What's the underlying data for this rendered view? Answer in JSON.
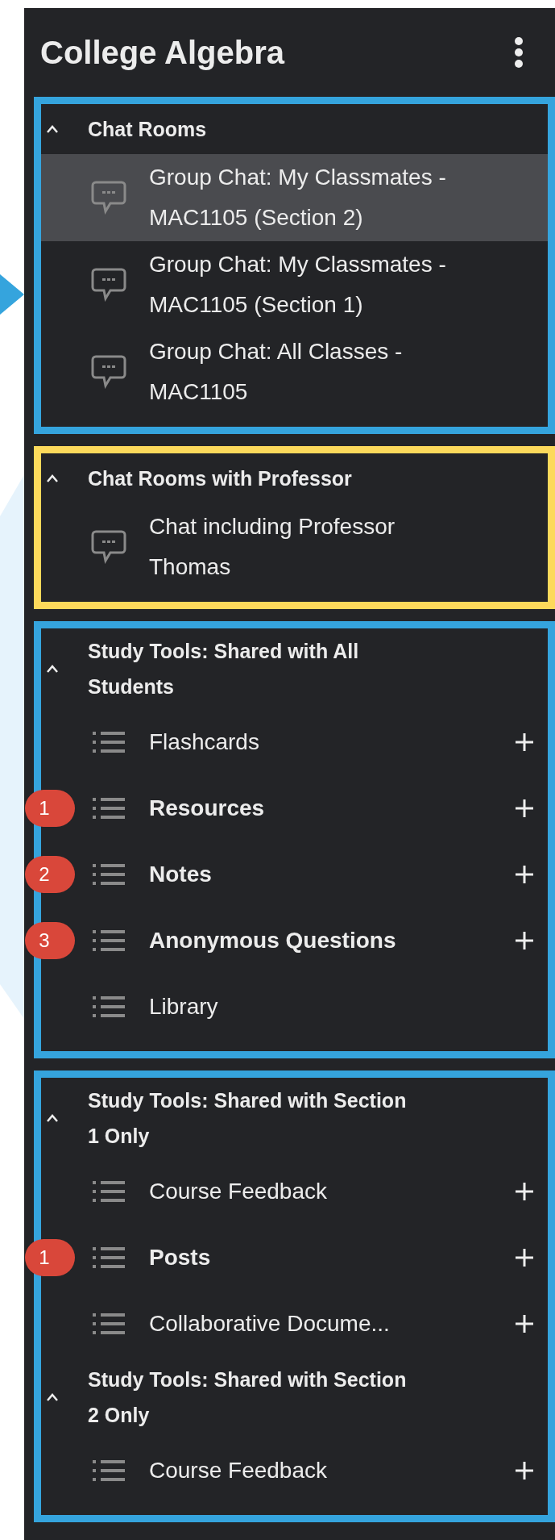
{
  "title": "College Algebra",
  "groups": [
    {
      "color": "#35a4dd",
      "sections": [
        {
          "heading": "Chat Rooms",
          "expanded": true,
          "items": [
            {
              "kind": "chat",
              "label": "Group Chat: My Classmates - MAC1105 (Section 2)",
              "selected": true
            },
            {
              "kind": "chat",
              "label": "Group Chat: My Classmates - MAC1105 (Section 1)",
              "selected": false
            },
            {
              "kind": "chat",
              "label": "Group Chat: All Classes - MAC1105",
              "selected": false
            }
          ]
        }
      ]
    },
    {
      "color": "#fcd95b",
      "sections": [
        {
          "heading": "Chat Rooms with Professor",
          "expanded": true,
          "items": [
            {
              "kind": "chat",
              "label": "Chat including Professor Thomas",
              "selected": false
            }
          ]
        }
      ]
    },
    {
      "color": "#35a4dd",
      "sections": [
        {
          "heading": "Study Tools: Shared with All Students",
          "expanded": true,
          "items": [
            {
              "kind": "tool",
              "label": "Flashcards",
              "selected": false,
              "addable": true
            },
            {
              "kind": "tool",
              "label": "Resources",
              "selected": false,
              "addable": true,
              "badge": "1"
            },
            {
              "kind": "tool",
              "label": "Notes",
              "selected": false,
              "addable": true,
              "badge": "2"
            },
            {
              "kind": "tool",
              "label": "Anonymous Questions",
              "selected": false,
              "addable": true,
              "badge": "3"
            },
            {
              "kind": "tool",
              "label": "Library",
              "selected": false,
              "addable": false
            }
          ]
        }
      ]
    },
    {
      "color": "#35a4dd",
      "sections": [
        {
          "heading": "Study Tools: Shared with Section 1 Only",
          "expanded": true,
          "items": [
            {
              "kind": "tool",
              "label": "Course Feedback",
              "selected": false,
              "addable": true
            },
            {
              "kind": "tool",
              "label": "Posts",
              "selected": false,
              "addable": true,
              "badge": "1"
            },
            {
              "kind": "tool",
              "label": "Collaborative Docume...",
              "selected": false,
              "addable": true
            }
          ]
        },
        {
          "heading": "Study Tools: Shared with Section 2 Only",
          "expanded": true,
          "items": [
            {
              "kind": "tool",
              "label": "Course Feedback",
              "selected": false,
              "addable": true
            }
          ]
        }
      ]
    }
  ]
}
